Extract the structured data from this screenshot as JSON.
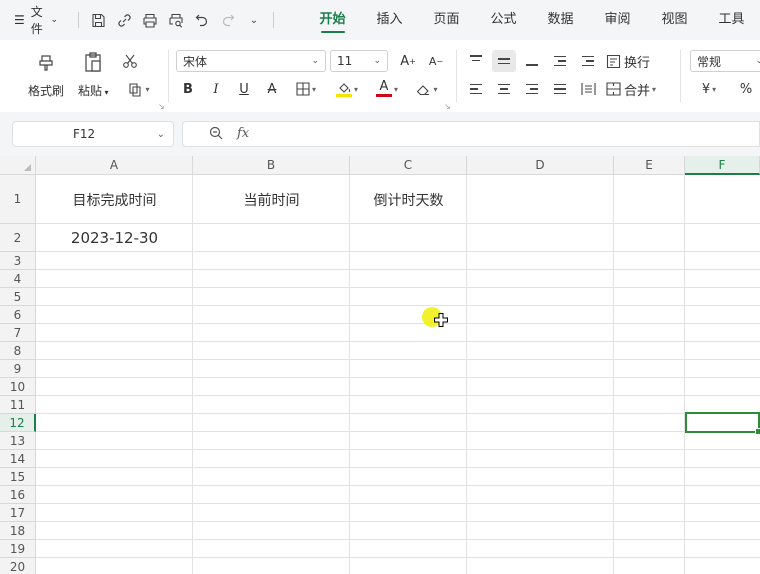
{
  "menubar": {
    "menu_icon": "hamburger-icon",
    "file_label": "文件",
    "tabs": [
      "开始",
      "插入",
      "页面",
      "公式",
      "数据",
      "审阅",
      "视图",
      "工具"
    ],
    "active_tab": "开始"
  },
  "ribbon": {
    "format_painter": "格式刷",
    "paste": "粘贴",
    "font_name": "宋体",
    "font_size": "11",
    "wrap_text": "换行",
    "merge": "合并",
    "number_format": "常规",
    "currency_symbol": "¥",
    "percent_symbol": "%",
    "bold": "B",
    "italic": "I",
    "underline": "U",
    "strike": "A",
    "font_color_letter": "A",
    "font_color": "#d0021b",
    "highlight_color": "#f5e400"
  },
  "formula_bar": {
    "cell_ref": "F12",
    "fx_label": "fx",
    "formula": ""
  },
  "sheet": {
    "columns": [
      "A",
      "B",
      "C",
      "D",
      "E",
      "F"
    ],
    "selected_column": "F",
    "rows": [
      "1",
      "2",
      "3",
      "4",
      "5",
      "6",
      "7",
      "8",
      "9",
      "10",
      "11",
      "12",
      "13",
      "14",
      "15",
      "16",
      "17",
      "18",
      "19",
      "20"
    ],
    "selected_row": "12",
    "cells": {
      "A1": "目标完成时间",
      "B1": "当前时间",
      "C1": "倒计时天数",
      "A2": "2023-12-30"
    },
    "selection_color": "#2e8b3a"
  }
}
